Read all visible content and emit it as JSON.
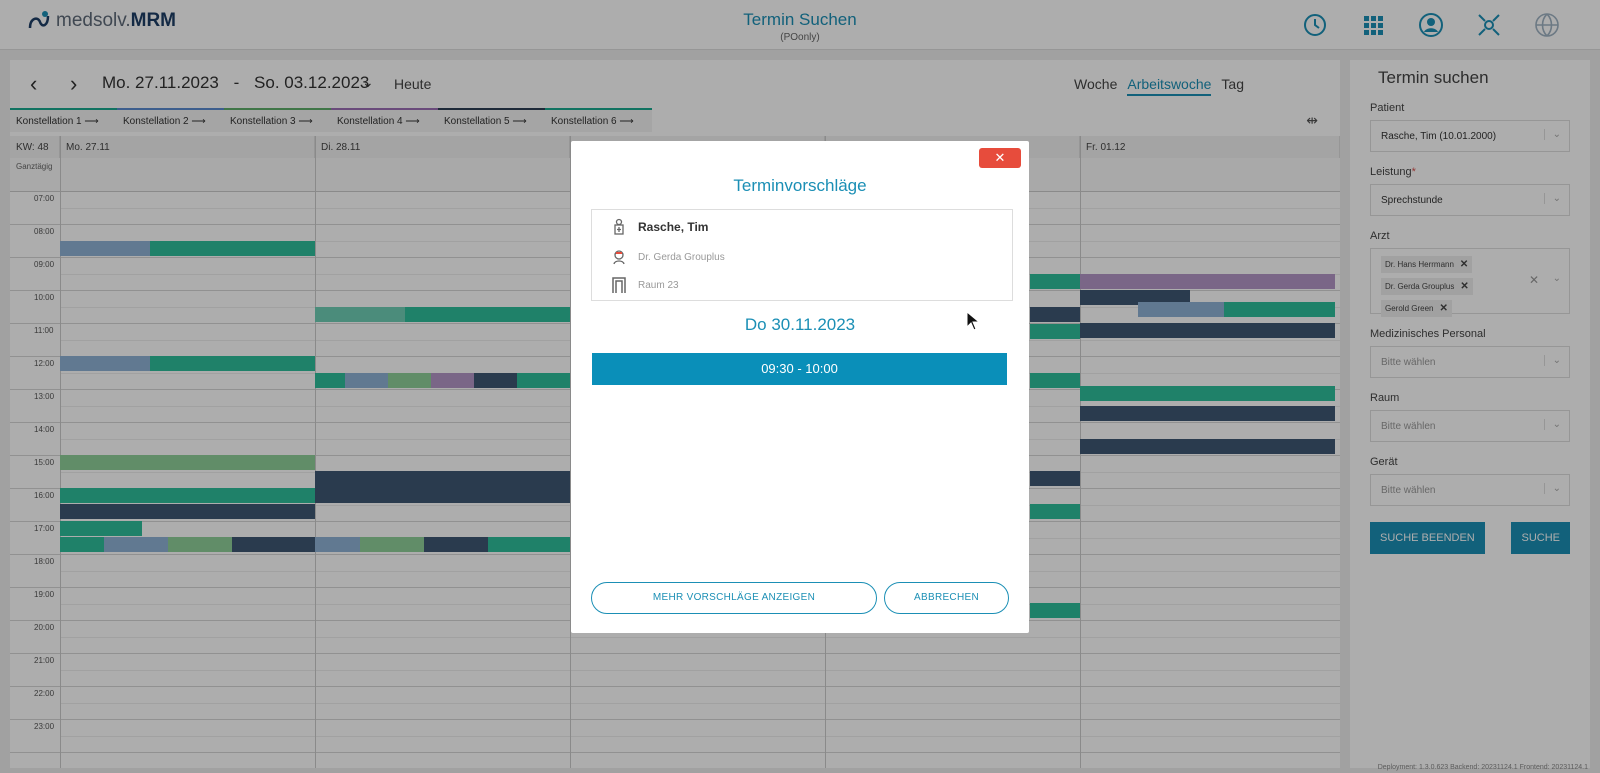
{
  "header": {
    "logo_prefix": "medsolv.",
    "logo_brand": "MRM",
    "title": "Termin Suchen",
    "subtitle": "(POonly)",
    "icons": [
      "clock-icon",
      "apps-grid-icon",
      "user-icon",
      "network-icon",
      "globe-icon"
    ]
  },
  "calendar": {
    "start_date": "Mo. 27.11.2023",
    "separator": "-",
    "end_date": "So. 03.12.2023",
    "today_label": "Heute",
    "views": [
      {
        "label": "Woche",
        "active": false
      },
      {
        "label": "Arbeitswoche",
        "active": true
      },
      {
        "label": "Tag",
        "active": false
      }
    ],
    "konstellationen": [
      "Konstellation 1",
      "Konstellation 2",
      "Konstellation 3",
      "Konstellation 4",
      "Konstellation 5",
      "Konstellation 6"
    ],
    "konst_colors": [
      "#1aaa8f",
      "#5b8bd0",
      "#5fae6b",
      "#9c6fb5",
      "#2d3e55",
      "#1aaa8f"
    ],
    "week_label": "KW: 48",
    "days": [
      "Mo. 27.11",
      "Di. 28.11",
      "",
      "",
      "Fr. 01.12"
    ],
    "allday_label": "Ganztägig",
    "hours": [
      "07:00",
      "08:00",
      "09:00",
      "10:00",
      "11:00",
      "12:00",
      "13:00",
      "14:00",
      "15:00",
      "16:00",
      "17:00",
      "18:00",
      "19:00",
      "20:00",
      "21:00",
      "22:00",
      "23:00"
    ]
  },
  "panel": {
    "title": "Termin suchen",
    "patient_label": "Patient",
    "patient_value": "Rasche, Tim (10.01.2000)",
    "leistung_label": "Leistung",
    "leistung_req": "*",
    "leistung_value": "Sprechstunde",
    "arzt_label": "Arzt",
    "arzt_tags": [
      "Dr. Hans Herrmann",
      "Dr. Gerda Grouplus",
      "Gerold Green"
    ],
    "personal_label": "Medizinisches Personal",
    "personal_placeholder": "Bitte wählen",
    "raum_label": "Raum",
    "raum_placeholder": "Bitte wählen",
    "geraet_label": "Gerät",
    "geraet_placeholder": "Bitte wählen",
    "end_search_label": "SUCHE BEENDEN",
    "search_label": "SUCHE"
  },
  "footer": "Deployment: 1.3.0.623  Backend: 20231124.1  Frontend: 20231124.1",
  "modal": {
    "close_label": "✕",
    "title": "Terminvorschläge",
    "patient": "Rasche, Tim",
    "doctor": "Dr. Gerda Grouplus",
    "room": "Raum 23",
    "date": "Do 30.11.2023",
    "slot": "09:30 - 10:00",
    "more_label": "MEHR VORSCHLÄGE ANZEIGEN",
    "cancel_label": "ABBRECHEN"
  },
  "colors": {
    "accent": "#1b8fb5",
    "green": "#2fbf9b",
    "navy": "#3f5774",
    "lightblue": "#8fb3d6",
    "lightgreen": "#8fd09a",
    "purple": "#b497c8",
    "close": "#e74c3c"
  }
}
